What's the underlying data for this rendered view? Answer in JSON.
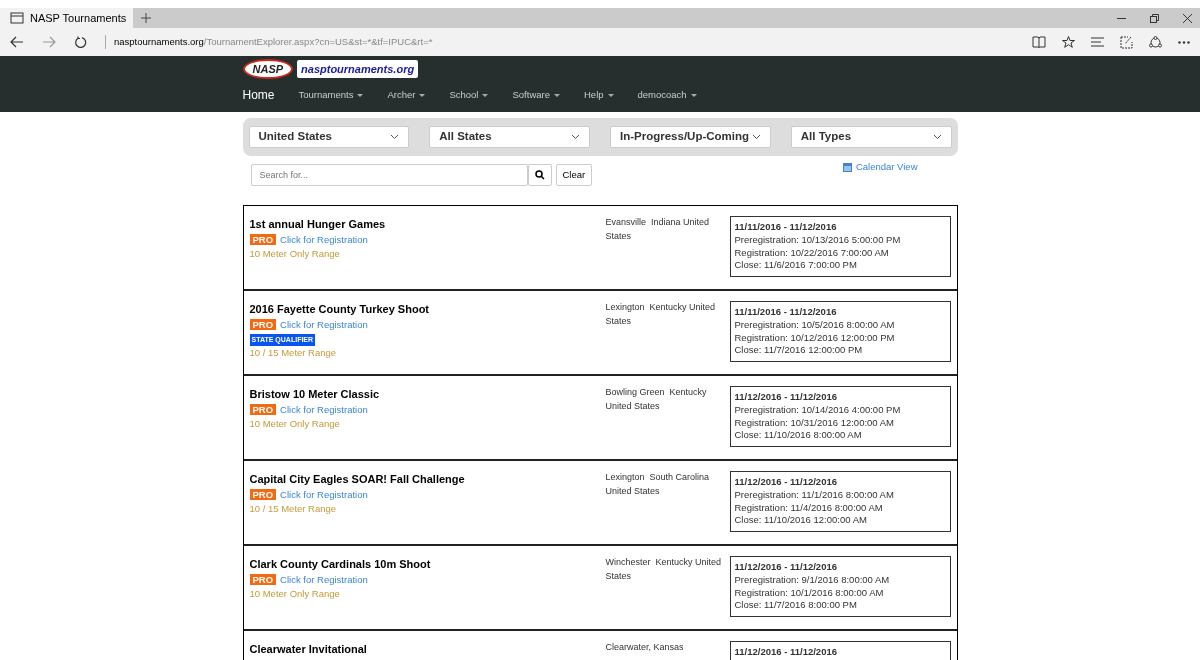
{
  "browser": {
    "tab_title": "NASP Tournaments",
    "url_host": "nasptournaments.org",
    "url_path": "/TournamentExplorer.aspx?cn=US&st=*&tf=IPUC&rt=*"
  },
  "site": {
    "logo_text": "NASP",
    "site_name": "nasptournaments.org",
    "nav": [
      {
        "label": "Home",
        "dropdown": false
      },
      {
        "label": "Tournaments",
        "dropdown": true
      },
      {
        "label": "Archer",
        "dropdown": true
      },
      {
        "label": "School",
        "dropdown": true
      },
      {
        "label": "Software",
        "dropdown": true
      },
      {
        "label": "Help",
        "dropdown": true
      },
      {
        "label": "democoach",
        "dropdown": true
      }
    ]
  },
  "filters": [
    "United States",
    "All States",
    "In-Progress/Up-Coming",
    "All Types"
  ],
  "search": {
    "placeholder": "Search for...",
    "clear": "Clear"
  },
  "calendar_link": "Calendar View",
  "tournaments": [
    {
      "name": "1st annual Hunger Games",
      "pro": "PRO",
      "link": "Click for Registration",
      "range": "10 Meter Only Range",
      "location": "Evansville  Indiana United States",
      "dates": "11/11/2016  - 11/12/2016",
      "prereg": "Preregistration: 10/13/2016 5:00:00 PM",
      "reg": "Registration: 10/22/2016 7:00:00 AM",
      "close": "Close: 11/6/2016 7:00:00 PM"
    },
    {
      "name": "2016 Fayette County Turkey Shoot",
      "pro": "PRO",
      "link": "Click for Registration",
      "qualifier": "STATE QUALIFIER",
      "range": "10 / 15 Meter Range",
      "location": "Lexington  Kentucky United States",
      "dates": "11/11/2016  - 11/12/2016",
      "prereg": "Preregistration: 10/5/2016 8:00:00 AM",
      "reg": "Registration: 10/12/2016 12:00:00 PM",
      "close": "Close: 11/7/2016 12:00:00 PM"
    },
    {
      "name": "Bristow 10 Meter Classic",
      "pro": "PRO",
      "link": "Click for Registration",
      "range": "10 Meter Only Range",
      "location": "Bowling Green  Kentucky United States",
      "dates": "11/12/2016  - 11/12/2016",
      "prereg": "Preregistration: 10/14/2016 4:00:00 PM",
      "reg": "Registration: 10/31/2016 12:00:00 AM",
      "close": "Close: 11/10/2016 8:00:00 AM"
    },
    {
      "name": "Capital City Eagles SOAR! Fall Challenge",
      "pro": "PRO",
      "link": "Click for Registration",
      "range": "10 / 15 Meter Range",
      "location": "Lexington  South Carolina United States",
      "dates": "11/12/2016  - 11/12/2016",
      "prereg": "Preregistration: 11/1/2016 8:00:00 AM",
      "reg": "Registration: 11/4/2016 8:00:00 AM",
      "close": "Close: 11/10/2016 12:00:00 AM"
    },
    {
      "name": "Clark County Cardinals 10m Shoot",
      "pro": "PRO",
      "link": "Click for Registration",
      "range": "10 Meter Only Range",
      "location": "Winchester  Kentucky United States",
      "dates": "11/12/2016  - 11/12/2016",
      "prereg": "Preregistration: 9/1/2016 8:00:00 AM",
      "reg": "Registration: 10/1/2016 8:00:00 AM",
      "close": "Close: 11/7/2016 8:00:00 PM"
    },
    {
      "name": "Clearwater Invitational",
      "location": "Clearwater, Kansas",
      "dates": "11/12/2016  - 11/12/2016"
    }
  ]
}
